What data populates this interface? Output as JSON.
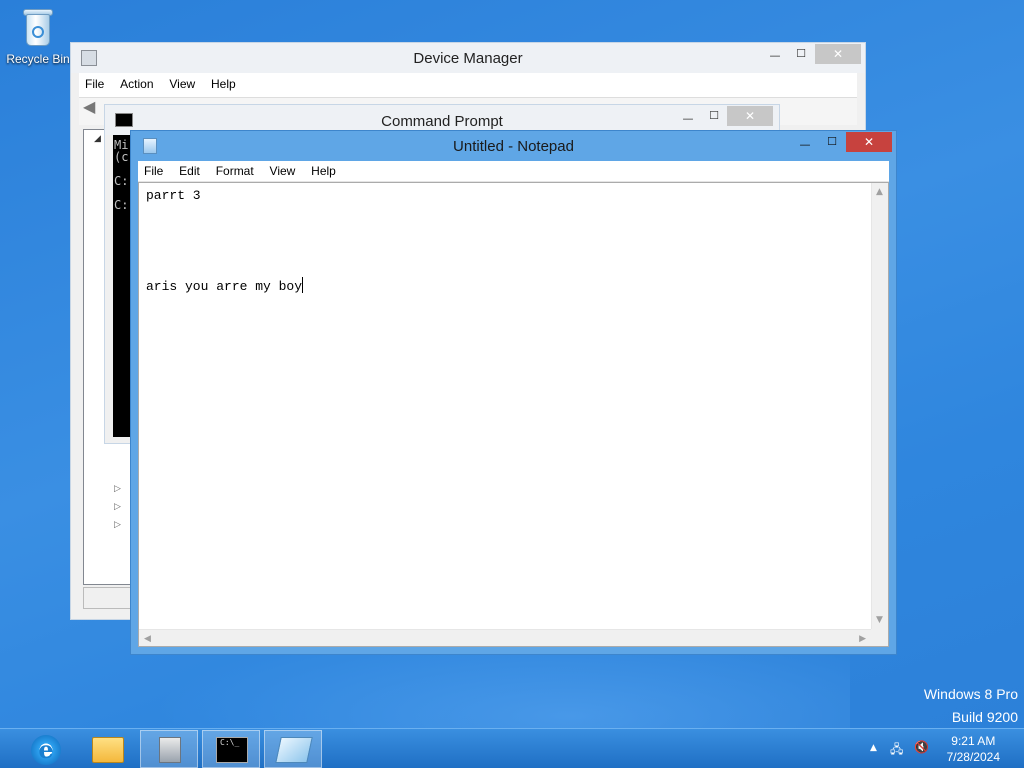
{
  "desktop": {
    "recycle_bin_label": "Recycle Bin",
    "watermark_line1": "Windows 8 Pro",
    "watermark_line2": "Build 9200"
  },
  "device_manager": {
    "title": "Device Manager",
    "menu": [
      "File",
      "Action",
      "View",
      "Help"
    ]
  },
  "command_prompt": {
    "title": "Command Prompt",
    "lines": [
      "Mi",
      "(c",
      "C:",
      "C:"
    ]
  },
  "notepad": {
    "title": "Untitled - Notepad",
    "menu": [
      "File",
      "Edit",
      "Format",
      "View",
      "Help"
    ],
    "text_line1": "parrt 3",
    "text_line2": "aris you arre my boy"
  },
  "window_controls": {
    "minimize": "—",
    "maximize": "☐",
    "close": "✕"
  },
  "taskbar": {
    "apps": [
      "internet-explorer",
      "file-explorer",
      "server-manager",
      "command-prompt",
      "notepad"
    ],
    "active_app": "notepad",
    "cmd_glyph_text": "C:\\_",
    "ie_glyph_text": "e",
    "clock_time": "9:21 AM",
    "clock_date": "7/28/2024",
    "tray_chevron": "▲",
    "tray_network": "🖧",
    "tray_volume": "🔇"
  },
  "colors": {
    "desktop_bg": "#2f86de",
    "notepad_frame": "#5fa6e6",
    "close_button_active": "#c7423e",
    "close_button_inactive": "#c7c7c7"
  }
}
